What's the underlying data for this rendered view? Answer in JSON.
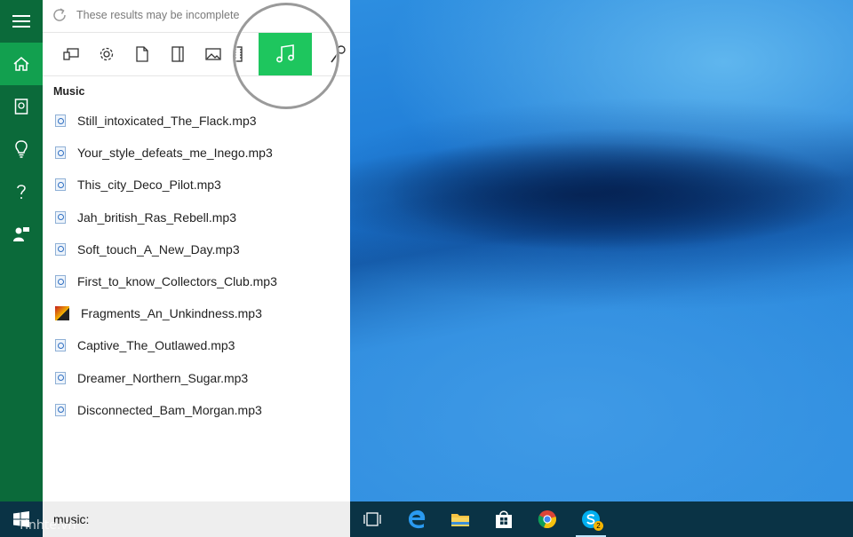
{
  "notice": {
    "text": "These results may be incomplete",
    "icon": "refresh-icon"
  },
  "rail": {
    "items": [
      {
        "name": "hamburger-menu",
        "icon": "hamburger-icon"
      },
      {
        "name": "home",
        "icon": "home-icon",
        "active": true
      },
      {
        "name": "notebook",
        "icon": "notebook-icon"
      },
      {
        "name": "reminders",
        "icon": "lightbulb-icon"
      },
      {
        "name": "help",
        "icon": "question-icon"
      },
      {
        "name": "feedback",
        "icon": "feedback-icon"
      }
    ]
  },
  "filters": {
    "items": [
      {
        "name": "apps",
        "icon": "apps-icon"
      },
      {
        "name": "settings",
        "icon": "gear-icon"
      },
      {
        "name": "documents",
        "icon": "document-icon"
      },
      {
        "name": "folders",
        "icon": "folder-icon"
      },
      {
        "name": "photos",
        "icon": "photo-icon"
      },
      {
        "name": "videos",
        "icon": "film-icon"
      },
      {
        "name": "music",
        "icon": "music-note-icon",
        "active": true
      },
      {
        "name": "web",
        "icon": "search-icon"
      }
    ],
    "active_color": "#1ec65e"
  },
  "section_title": "Music",
  "results": [
    {
      "name": "Still_intoxicated_The_Flack.mp3",
      "icon": "audio-file-icon"
    },
    {
      "name": "Your_style_defeats_me_Inego.mp3",
      "icon": "audio-file-icon"
    },
    {
      "name": "This_city_Deco_Pilot.mp3",
      "icon": "audio-file-icon"
    },
    {
      "name": "Jah_british_Ras_Rebell.mp3",
      "icon": "audio-file-icon"
    },
    {
      "name": "Soft_touch_A_New_Day.mp3",
      "icon": "audio-file-icon"
    },
    {
      "name": "First_to_know_Collectors_Club.mp3",
      "icon": "audio-file-icon"
    },
    {
      "name": "Fragments_An_Unkindness.mp3",
      "icon": "album-art-icon"
    },
    {
      "name": "Captive_The_Outlawed.mp3",
      "icon": "audio-file-icon"
    },
    {
      "name": "Dreamer_Northern_Sugar.mp3",
      "icon": "audio-file-icon"
    },
    {
      "name": "Disconnected_Bam_Morgan.mp3",
      "icon": "audio-file-icon"
    }
  ],
  "search": {
    "value": "music:"
  },
  "taskbar": {
    "apps": [
      {
        "name": "task-view",
        "icon": "task-view-icon"
      },
      {
        "name": "edge",
        "icon": "edge-icon"
      },
      {
        "name": "file-explorer",
        "icon": "folder-icon"
      },
      {
        "name": "store",
        "icon": "store-icon"
      },
      {
        "name": "chrome",
        "icon": "chrome-icon"
      },
      {
        "name": "skype",
        "icon": "skype-icon",
        "badge": "2",
        "running": true
      }
    ]
  },
  "watermark": "Tinhte.vn",
  "colors": {
    "rail": "#0b6a3a",
    "rail_active": "#12a04f",
    "taskbar": "#0a3345"
  }
}
